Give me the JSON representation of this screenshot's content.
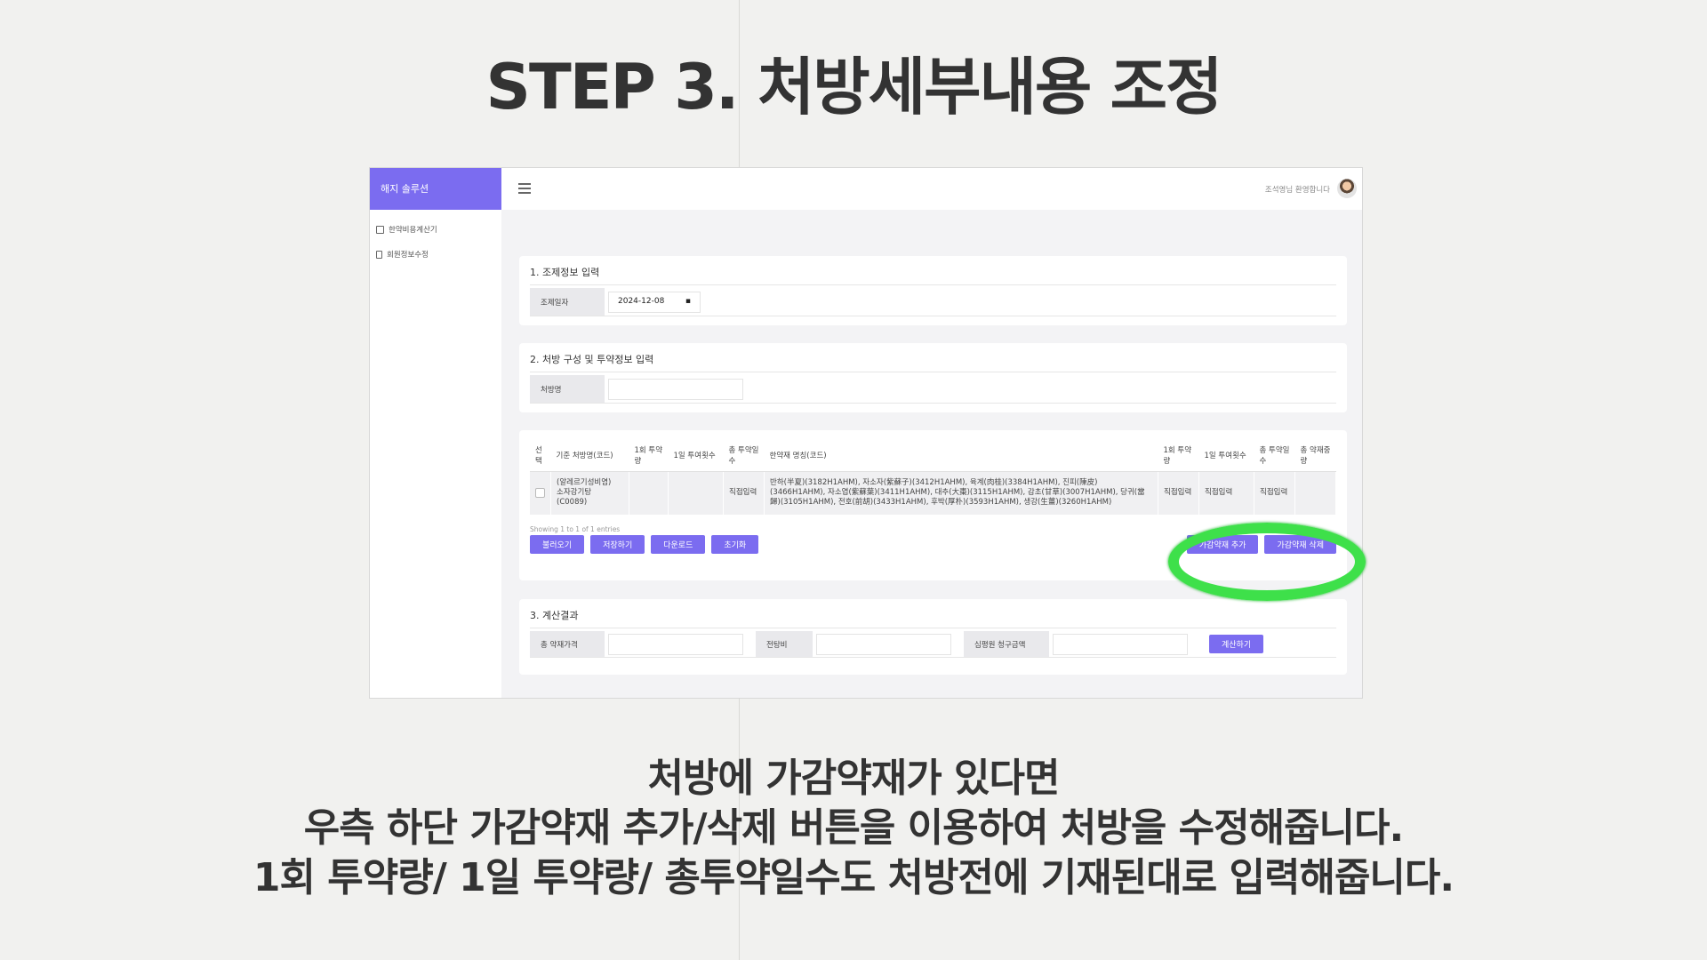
{
  "slide": {
    "title": "STEP 3. 처방세부내용 조정",
    "caption_lines": [
      "처방에 가감약재가 있다면",
      "우측 하단 가감약재 추가/삭제 버튼을 이용하여 처방을 수정해줍니다.",
      "1회 투약량/ 1일 투약량/ 총투약일수도 처방전에 기재된대로 입력해줍니다."
    ]
  },
  "app": {
    "brand": "해지 솔루션",
    "nav": [
      {
        "label": "한약비용계산기",
        "icon": "edit-icon"
      },
      {
        "label": "회원정보수정",
        "icon": "document-icon"
      }
    ],
    "welcome": "조석영님 환영합니다"
  },
  "section1": {
    "title": "1. 조제정보 입력",
    "date_label": "조제일자",
    "date_value": "2024-12-08"
  },
  "section2": {
    "title": "2. 처방 구성 및 투약정보 입력",
    "name_label": "처방명",
    "name_value": ""
  },
  "table": {
    "headers": [
      "선택",
      "기준 처방명(코드)",
      "1회 투약량",
      "1일 투여횟수",
      "총 투약일수",
      "한약재 명칭(코드)",
      "1회 투약량",
      "1일 투여횟수",
      "총 투약일수",
      "총 약재중량"
    ],
    "row": {
      "prescription": [
        "(알레르기성비염)",
        "소자강기탕",
        "(C0089)"
      ],
      "days": "직접입력",
      "herbs": "반하(半夏)(3182H1AHM), 자소자(紫蘇子)(3412H1AHM), 육계(肉桂)(3384H1AHM), 진피(陳皮)(3466H1AHM), 자소엽(紫蘇葉)(3411H1AHM), 대추(大棗)(3115H1AHM), 감초(甘草)(3007H1AHM), 당귀(當歸)(3105H1AHM), 전호(前胡)(3433H1AHM), 후박(厚朴)(3593H1AHM), 생강(生薑)(3260H1AHM)",
      "dose": "직접입력",
      "freq": "직접입력",
      "days2": "직접입력"
    },
    "entries": "Showing 1 to 1 of 1 entries",
    "buttons_left": [
      "불러오기",
      "저장하기",
      "다운로드",
      "초기화"
    ],
    "buttons_right": [
      "가감약재 추가",
      "가감약재 삭제"
    ]
  },
  "section3": {
    "title": "3. 계산결과",
    "labels": [
      "총 약재가격",
      "전탕비",
      "심평원 청구금액"
    ],
    "calc_button": "계산하기"
  },
  "colors": {
    "accent": "#7b6cf0",
    "highlight": "#3ee04a"
  }
}
